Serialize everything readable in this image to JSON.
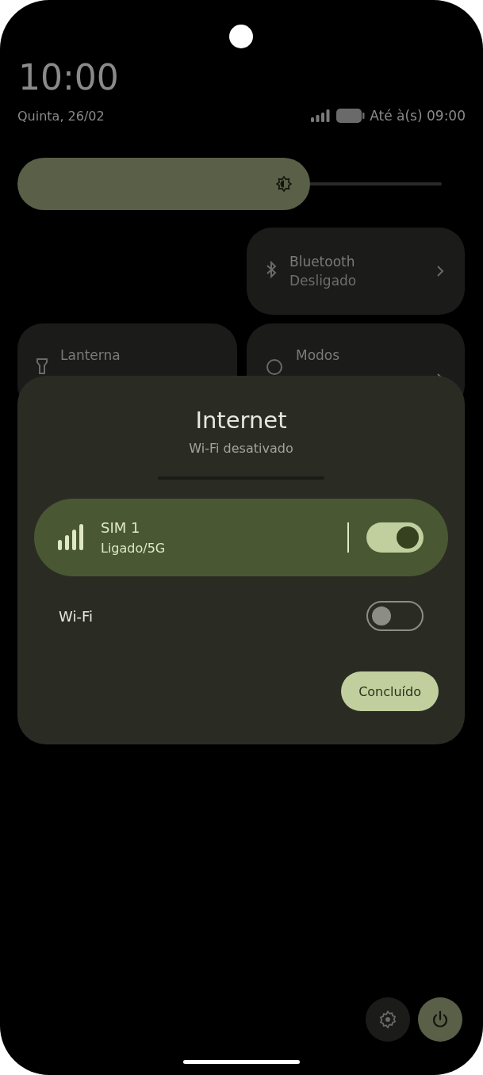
{
  "header": {
    "time": "10:00",
    "date": "Quinta, 26/02",
    "alarm": "Até à(s) 09:00"
  },
  "brightness": {
    "level": 0.69
  },
  "tiles": [
    {
      "kind": "bluetooth",
      "label": "Bluetooth",
      "status": "Desligado",
      "chevron": true
    },
    {
      "kind": "flashlight",
      "label": "Lanterna",
      "chevron": false
    },
    {
      "kind": "modes",
      "label": "Modos",
      "chevron": true
    }
  ],
  "dialog": {
    "title": "Internet",
    "subtitle": "Wi-Fi desativado",
    "networks": [
      {
        "name": "SIM 1",
        "status": "Ligado/5G",
        "active": true,
        "on": true
      },
      {
        "name": "Wi-Fi",
        "active": false,
        "on": false
      }
    ],
    "button": "Concluído"
  }
}
